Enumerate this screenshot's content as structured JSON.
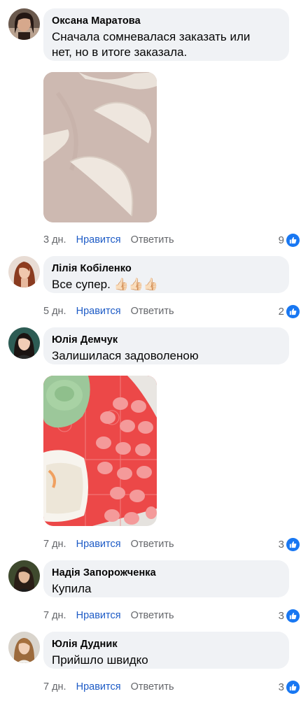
{
  "comments": [
    {
      "author": "Оксана Маратова",
      "text_line1": "Сначала сомневалася заказать или",
      "text_line2": "нет, но в итоге заказала.",
      "time": "3 дн.",
      "like_label": "Нравится",
      "reply_label": "Ответить",
      "reaction_count": "9"
    },
    {
      "author": "Лілія Кобіленко",
      "text": "Все супер. 👍🏻👍🏻👍🏻",
      "time": "5 дн.",
      "like_label": "Нравится",
      "reply_label": "Ответить",
      "reaction_count": "2"
    },
    {
      "author": "Юлія Демчук",
      "text": "Залишилася задоволеною",
      "time": "7 дн.",
      "like_label": "Нравится",
      "reply_label": "Ответить",
      "reaction_count": "3"
    },
    {
      "author": "Надія Запорожченка",
      "text": "Купила",
      "time": "7 дн.",
      "like_label": "Нравится",
      "reply_label": "Ответить",
      "reaction_count": "3"
    },
    {
      "author": "Юлія Дудник",
      "text": "Прийшло швидко",
      "time": "7 дн.",
      "like_label": "Нравится",
      "reply_label": "Ответить",
      "reaction_count": "3"
    }
  ],
  "colors": {
    "bubble": "#f0f2f5",
    "link": "#1d5bc6",
    "meta": "#65676b",
    "like_badge": "#1877f2"
  },
  "icons": {
    "reaction": "thumbs-up-icon"
  }
}
